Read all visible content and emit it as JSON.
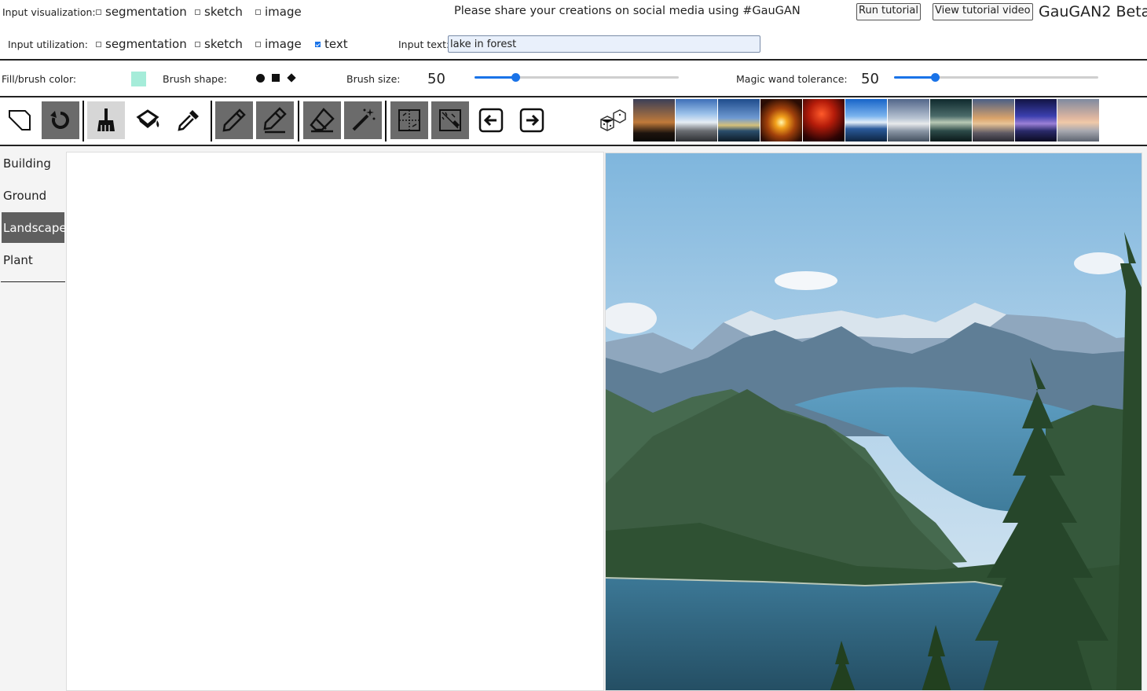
{
  "header": {
    "input_visualization_label": "Input visualization:",
    "input_utilization_label": "Input utilization:",
    "vis_options": [
      {
        "label": "segmentation",
        "checked": false
      },
      {
        "label": "sketch",
        "checked": false
      },
      {
        "label": "image",
        "checked": false
      }
    ],
    "util_options": [
      {
        "label": "segmentation",
        "checked": false
      },
      {
        "label": "sketch",
        "checked": false
      },
      {
        "label": "image",
        "checked": false
      },
      {
        "label": "text",
        "checked": true
      }
    ],
    "share_message": "Please share your creations on social media using #GauGAN",
    "run_tutorial": "Run tutorial",
    "view_tutorial_video": "View tutorial video",
    "brand": "GauGAN2 Beta",
    "input_text_label": "Input text:",
    "input_text_value": "lake in forest"
  },
  "brush_row": {
    "fill_color_label": "Fill/brush color:",
    "fill_color": "#a5ecd9",
    "brush_shape_label": "Brush shape:",
    "brush_shapes": [
      "circle",
      "square",
      "diamond"
    ],
    "brush_size_label": "Brush size:",
    "brush_size": "50",
    "brush_size_fraction": 0.2,
    "magic_wand_label": "Magic wand tolerance:",
    "magic_wand": "50",
    "magic_wand_fraction": 0.2
  },
  "toolbar": {
    "tools": [
      "new-canvas-icon",
      "rotate-icon",
      "brush-icon",
      "fill-bucket-icon",
      "eyedropper-icon",
      "pencil-icon",
      "pencil-eraser-icon",
      "eraser-icon",
      "magic-wand-icon",
      "segmentation-map-icon",
      "sketch-map-icon",
      "undo-icon",
      "redo-icon",
      "random-dice-icon"
    ],
    "style_thumbnails": 11
  },
  "sidebar": {
    "categories": [
      {
        "label": "Building",
        "selected": false
      },
      {
        "label": "Ground",
        "selected": false
      },
      {
        "label": "Landscape",
        "selected": true
      },
      {
        "label": "Plant",
        "selected": false
      }
    ]
  },
  "colors": {
    "accent": "#1a73e8",
    "selected_bg": "#5f5f5f",
    "tool_dark": "#6b6b6b"
  }
}
